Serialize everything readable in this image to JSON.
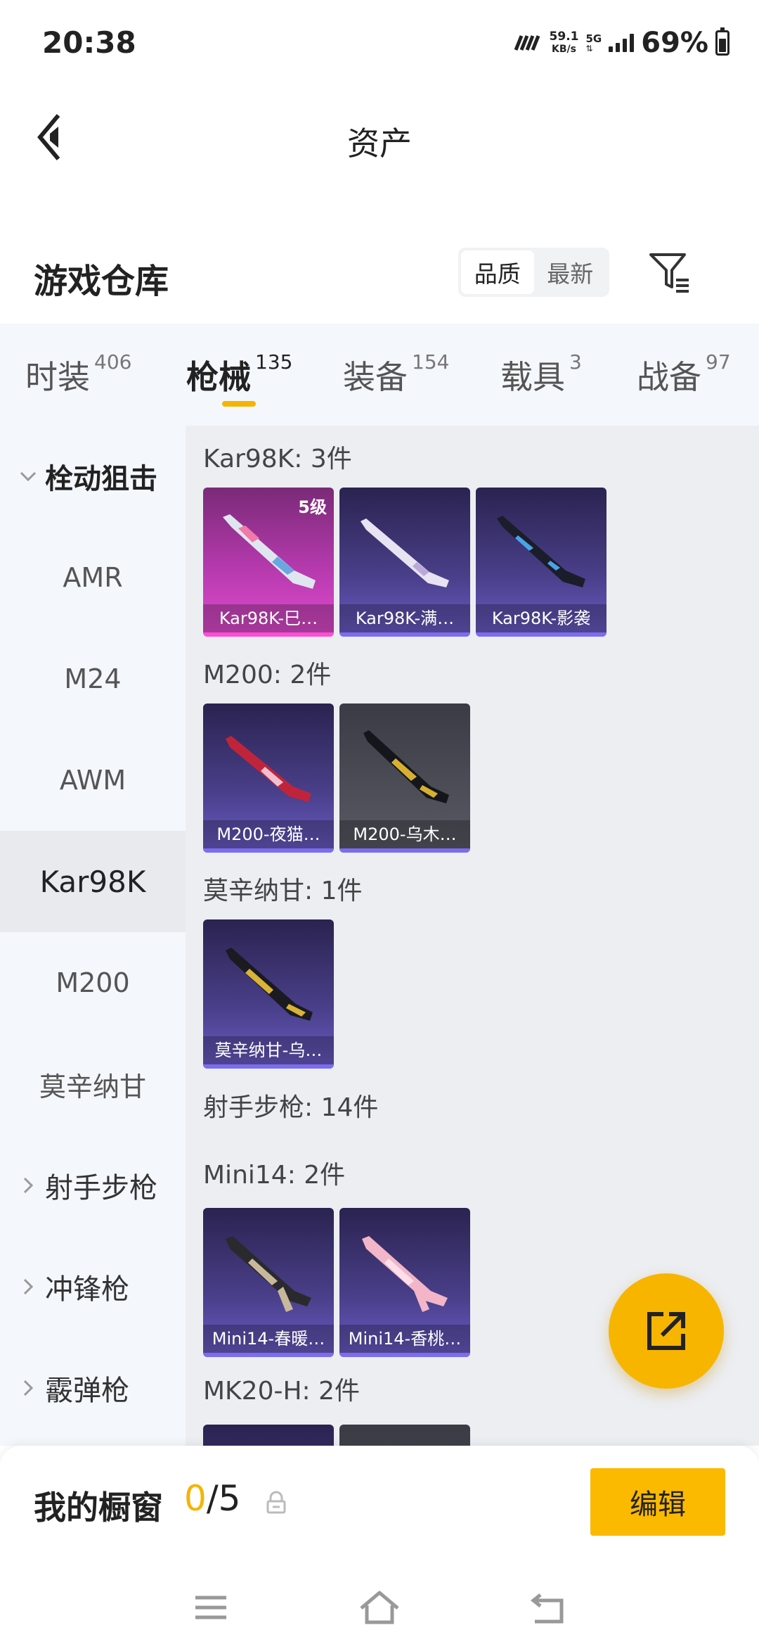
{
  "status": {
    "time": "20:38",
    "speed_value": "59.1",
    "speed_unit": "KB/s",
    "network": "5G",
    "battery": "69%"
  },
  "header": {
    "title": "资产"
  },
  "warehouse": {
    "title": "游戏仓库",
    "sort_options": [
      "品质",
      "最新"
    ],
    "sort_selected": "品质"
  },
  "tabs": [
    {
      "label": "时装",
      "count": "406"
    },
    {
      "label": "枪械",
      "count": "135"
    },
    {
      "label": "装备",
      "count": "154"
    },
    {
      "label": "载具",
      "count": "3"
    },
    {
      "label": "战备",
      "count": "97"
    }
  ],
  "active_tab": "枪械",
  "sidebar": {
    "items": [
      {
        "label": "栓动狙击",
        "kind": "group",
        "expanded": true
      },
      {
        "label": "AMR",
        "kind": "sub"
      },
      {
        "label": "M24",
        "kind": "sub"
      },
      {
        "label": "AWM",
        "kind": "sub"
      },
      {
        "label": "Kar98K",
        "kind": "sub",
        "selected": true
      },
      {
        "label": "M200",
        "kind": "sub"
      },
      {
        "label": "莫辛纳甘",
        "kind": "sub"
      },
      {
        "label": "射手步枪",
        "kind": "group",
        "expanded": false
      },
      {
        "label": "冲锋枪",
        "kind": "group",
        "expanded": false
      },
      {
        "label": "霰弹枪",
        "kind": "group",
        "expanded": false
      }
    ]
  },
  "content": {
    "groups": [
      {
        "heading": "Kar98K: 3件",
        "items": [
          {
            "name": "Kar98K-巳…",
            "tier": "pink",
            "level": "5级"
          },
          {
            "name": "Kar98K-满…",
            "tier": "purple"
          },
          {
            "name": "Kar98K-影袭",
            "tier": "purple"
          }
        ]
      },
      {
        "heading": "M200: 2件",
        "items": [
          {
            "name": "M200-夜猫…",
            "tier": "purple"
          },
          {
            "name": "M200-乌木…",
            "tier": "grey"
          }
        ]
      },
      {
        "heading": "莫辛纳甘: 1件",
        "items": [
          {
            "name": "莫辛纳甘-乌…",
            "tier": "purple"
          }
        ]
      },
      {
        "heading": "射手步枪: 14件",
        "items": []
      },
      {
        "heading": "Mini14: 2件",
        "items": [
          {
            "name": "Mini14-春暖…",
            "tier": "purple"
          },
          {
            "name": "Mini14-香桃…",
            "tier": "purple"
          }
        ]
      },
      {
        "heading": "MK20-H: 2件",
        "items": []
      }
    ]
  },
  "showcase": {
    "title": "我的橱窗",
    "used": "0",
    "total": "/5",
    "edit_label": "编辑"
  },
  "colors": {
    "accent": "#f5b400",
    "purple_card": "#4a3f8a",
    "pink_card": "#b63aae"
  }
}
